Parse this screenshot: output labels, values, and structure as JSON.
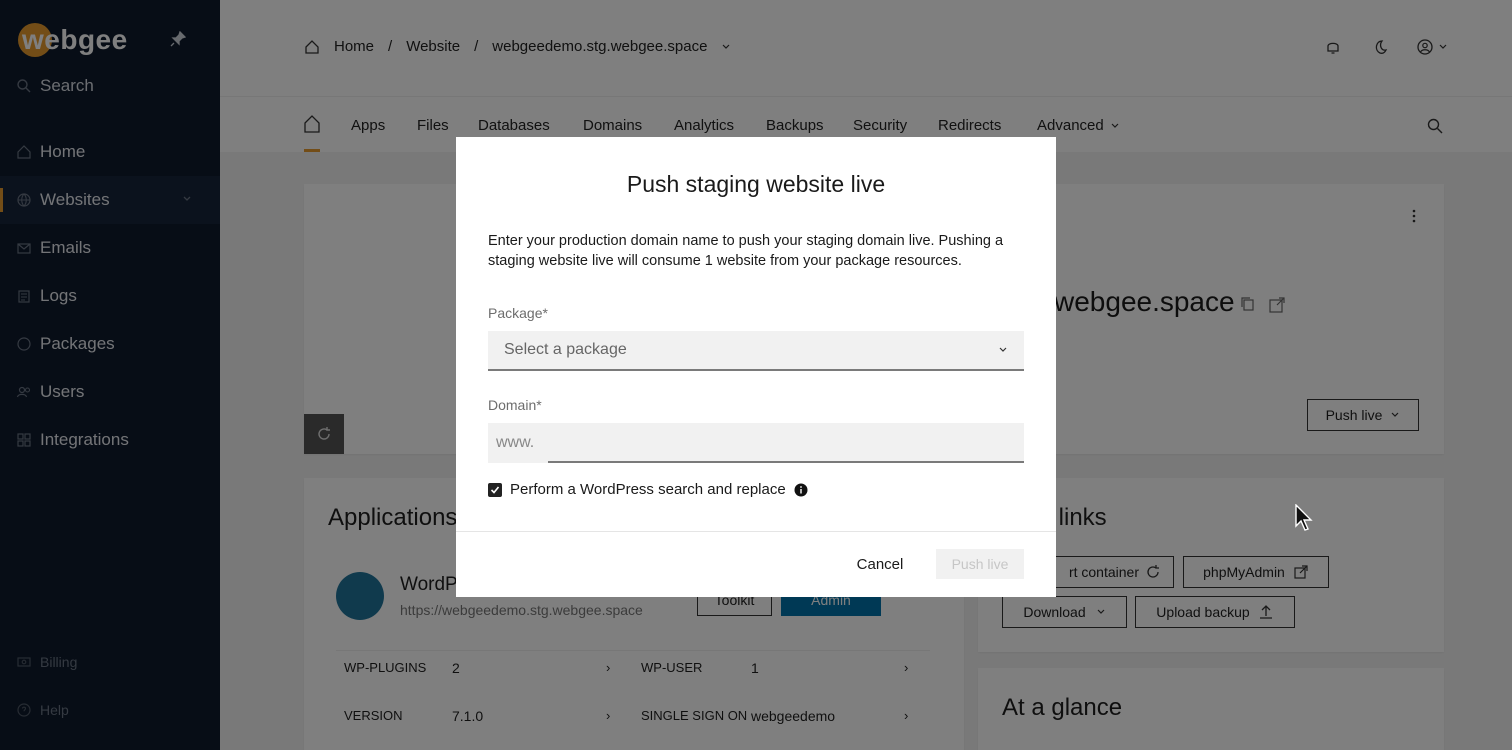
{
  "sidebar": {
    "logo": "webgee",
    "search_label": "Search",
    "items": [
      {
        "label": "Home"
      },
      {
        "label": "Websites"
      },
      {
        "label": "Emails"
      },
      {
        "label": "Logs"
      },
      {
        "label": "Packages"
      },
      {
        "label": "Users"
      },
      {
        "label": "Integrations"
      }
    ],
    "bottom": [
      {
        "label": "Billing"
      },
      {
        "label": "Help"
      }
    ]
  },
  "header": {
    "breadcrumb": [
      "Home",
      "Website",
      "webgeedemo.stg.webgee.space"
    ]
  },
  "tabs": [
    "Apps",
    "Files",
    "Databases",
    "Domains",
    "Analytics",
    "Backups",
    "Security",
    "Redirects",
    "Advanced"
  ],
  "background": {
    "site_title_partial": "webgee.space",
    "push_live_btn": "Push live",
    "applications_title": "Applications",
    "app_name": "WordP",
    "app_url": "https://webgeedemo.stg.webgee.space",
    "toolkit_btn": "Toolkit",
    "admin_btn": "Admin",
    "rows": [
      {
        "k1": "WP-PLUGINS",
        "v1": "2",
        "k2": "WP-USER",
        "v2": "1"
      },
      {
        "k1": "VERSION",
        "v1": "7.1.0",
        "k2": "SINGLE SIGN ON",
        "v2": "webgeedemo"
      }
    ],
    "quick_links_title": "k links",
    "restart_btn": "rt container",
    "phpmyadmin_btn": "phpMyAdmin",
    "download_btn": "Download",
    "upload_btn": "Upload backup",
    "glance_title": "At a glance"
  },
  "modal": {
    "title": "Push staging website live",
    "description": "Enter your production domain name to push your staging domain live. Pushing a staging website live will consume 1 website from your package resources.",
    "package_label": "Package*",
    "package_placeholder": "Select a package",
    "domain_label": "Domain*",
    "domain_prefix": "www.",
    "domain_value": "",
    "checkbox_label": "Perform a WordPress search and replace",
    "checkbox_checked": true,
    "cancel_label": "Cancel",
    "push_label": "Push live"
  },
  "colors": {
    "sidebar_bg": "#0f1b2d",
    "accent": "#e69a2e",
    "admin_btn": "#0073aa"
  }
}
